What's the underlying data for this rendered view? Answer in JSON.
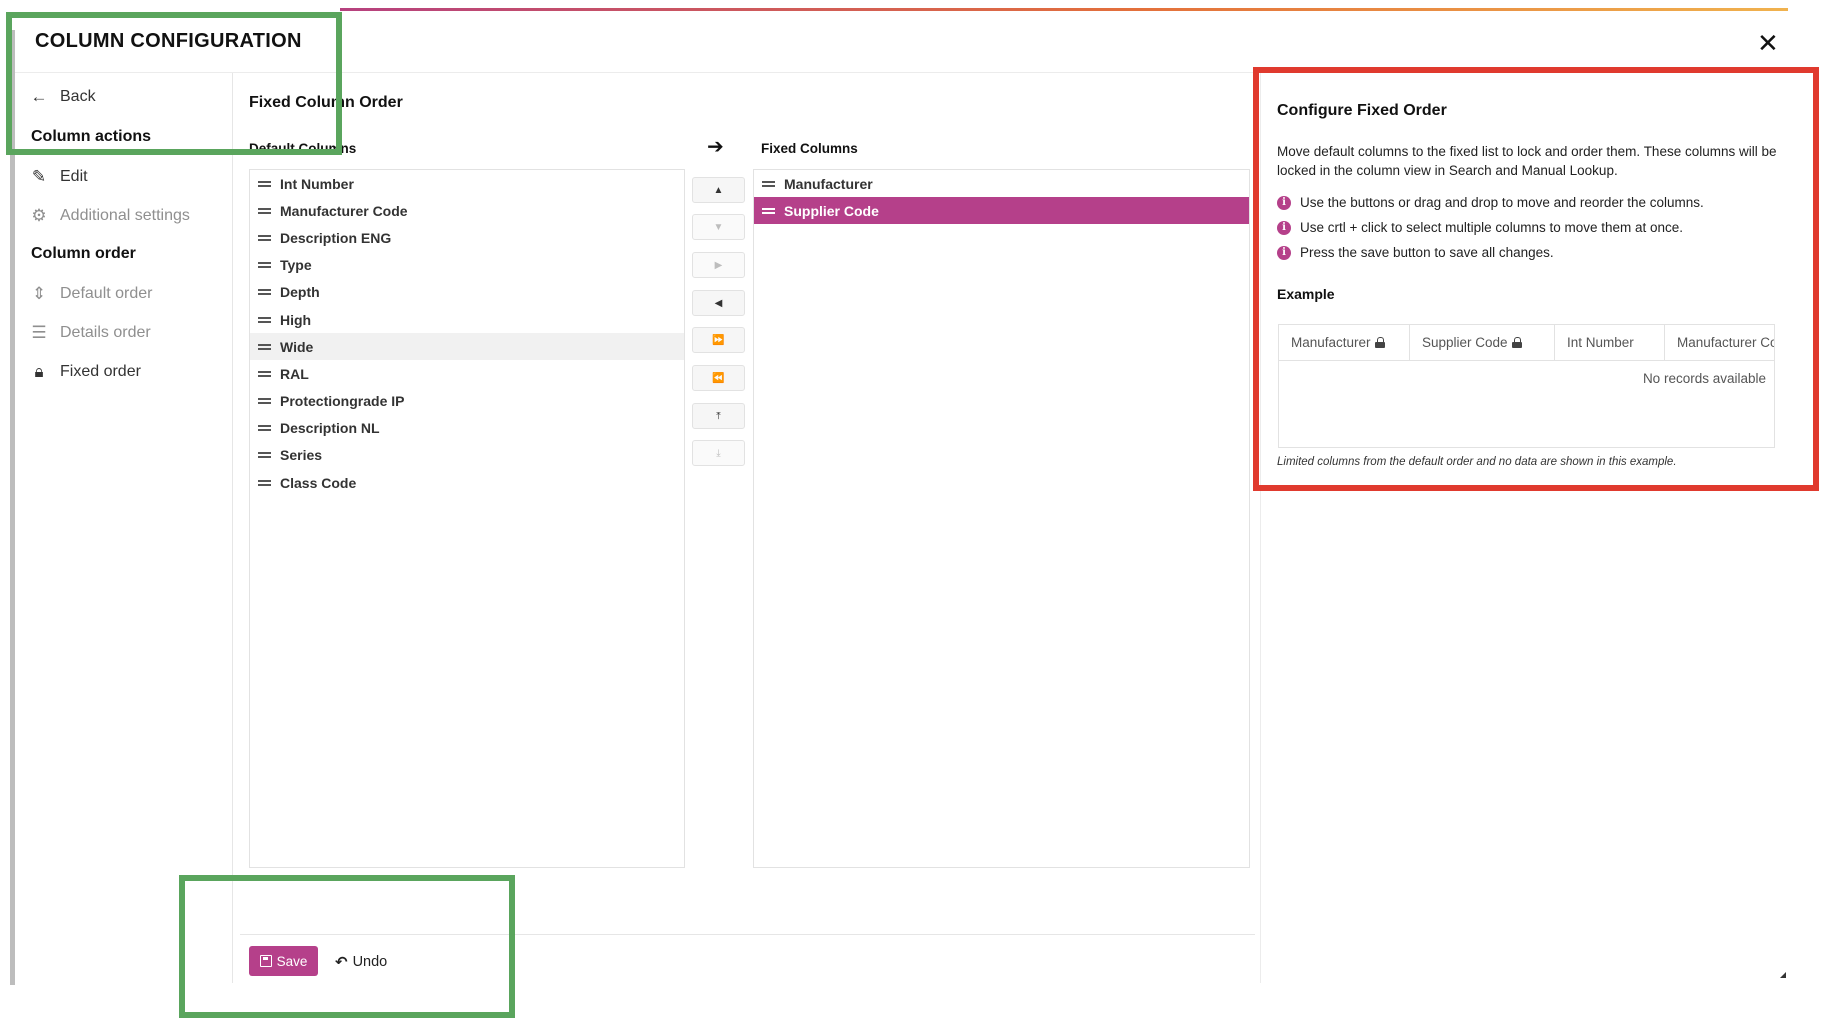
{
  "header": {
    "title": "COLUMN CONFIGURATION",
    "close_glyph": "✕"
  },
  "sidebar": {
    "back_label": "Back",
    "section_actions": "Column actions",
    "edit_label": "Edit",
    "additional_settings_label": "Additional settings",
    "section_order": "Column order",
    "default_order_label": "Default order",
    "details_order_label": "Details order",
    "fixed_order_label": "Fixed order",
    "icons": {
      "back": "arrow-left-icon",
      "edit": "pencil-icon",
      "additional_settings": "gear-icon",
      "default_order": "sort-icon",
      "details_order": "list-icon",
      "fixed_order": "lock-icon"
    }
  },
  "main": {
    "section_title": "Fixed Column Order",
    "default_columns_header": "Default Columns",
    "fixed_columns_header": "Fixed Columns",
    "default_columns": [
      "Int Number",
      "Manufacturer Code",
      "Description ENG",
      "Type",
      "Depth",
      "High",
      "Wide",
      "RAL",
      "Protectiongrade IP",
      "Description NL",
      "Series",
      "Class Code"
    ],
    "hovered_default_column": "Wide",
    "fixed_columns": [
      "Manufacturer",
      "Supplier Code"
    ],
    "selected_fixed_column": "Supplier Code",
    "move_buttons": {
      "up": "▲",
      "down": "▼",
      "right": "▶",
      "left": "◀",
      "all_right": "⏩",
      "all_left": "⏪",
      "top": "⤒",
      "bottom": "⤓"
    }
  },
  "footer": {
    "save_label": "Save",
    "undo_label": "Undo"
  },
  "help_panel": {
    "title": "Configure Fixed Order",
    "description": "Move default columns to the fixed list to lock and order them. These columns will be locked in the column view in Search and Manual Lookup.",
    "tips": [
      "Use the buttons or drag and drop to move and reorder the columns.",
      "Use crtl + click to select multiple columns to move them at once.",
      "Press the save button to save all changes."
    ],
    "example_title": "Example",
    "example_columns": [
      "Manufacturer",
      "Supplier Code",
      "Int Number",
      "Manufacturer Code"
    ],
    "empty_text": "No records available",
    "note": "Limited columns from the default order and no data are shown in this example."
  },
  "colors": {
    "accent": "#b5408a",
    "annotation_green": "#5aa55d",
    "annotation_red": "#e03a2e"
  }
}
